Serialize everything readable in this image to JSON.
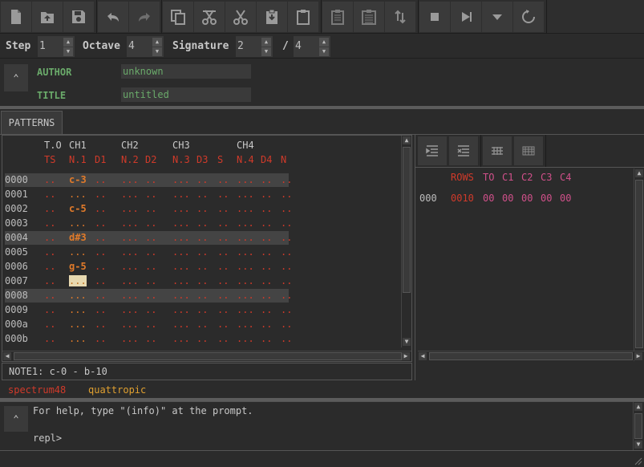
{
  "toolbar": {
    "buttons": [
      "new-file",
      "open-file",
      "save-file",
      "undo",
      "redo",
      "copy",
      "cut-pattern",
      "cut",
      "paste-special",
      "paste",
      "clipboard-text",
      "clipboard-lines",
      "swap-vertical",
      "stop",
      "play",
      "dropdown",
      "refresh"
    ]
  },
  "params": {
    "step_label": "Step",
    "step_value": "1",
    "octave_label": "Octave",
    "octave_value": "4",
    "signature_label": "Signature",
    "sig_num": "2",
    "sig_sep": "/",
    "sig_den": "4"
  },
  "meta": {
    "author_label": "AUTHOR",
    "author_value": "unknown",
    "title_label": "TITLE",
    "title_value": "untitled"
  },
  "patterns": {
    "tab_label": "PATTERNS",
    "header1": [
      "T.O",
      "CH1",
      "CH2",
      "CH3",
      "CH4"
    ],
    "header2": [
      "TS",
      "N.1",
      "D1",
      "N.2",
      "D2",
      "N.3",
      "D3",
      "S",
      "N.4",
      "D4",
      "N"
    ],
    "rows": [
      {
        "id": "0000",
        "note": "c-3"
      },
      {
        "id": "0001",
        "note": "..."
      },
      {
        "id": "0002",
        "note": "c-5"
      },
      {
        "id": "0003",
        "note": "..."
      },
      {
        "id": "0004",
        "note": "d#3"
      },
      {
        "id": "0005",
        "note": "..."
      },
      {
        "id": "0006",
        "note": "g-5"
      },
      {
        "id": "0007",
        "note": "..."
      },
      {
        "id": "0008",
        "note": "..."
      },
      {
        "id": "0009",
        "note": "..."
      },
      {
        "id": "000a",
        "note": "..."
      },
      {
        "id": "000b",
        "note": "..."
      }
    ],
    "empty_ts": "..",
    "empty_d": "..",
    "empty_n": "...",
    "status": "NOTE1: c-0 - b-10"
  },
  "sequence": {
    "headers": [
      "ROWS",
      "TO",
      "C1",
      "C2",
      "C3",
      "C4"
    ],
    "row": {
      "id": "000",
      "rows": "0010",
      "to": "00",
      "c1": "00",
      "c2": "00",
      "c3": "00",
      "c4": "00"
    }
  },
  "tags": {
    "tag1": "spectrum48",
    "tag2": "quattropic"
  },
  "console": {
    "help_line": "For help, type \"(info)\" at the prompt.",
    "prompt": "repl>"
  },
  "colors": {
    "accent_red": "#d03a2a",
    "note_orange": "#e07a2a",
    "pink": "#d0508a",
    "green_label": "#6aaa6a",
    "tag_yellow": "#e0a030"
  }
}
